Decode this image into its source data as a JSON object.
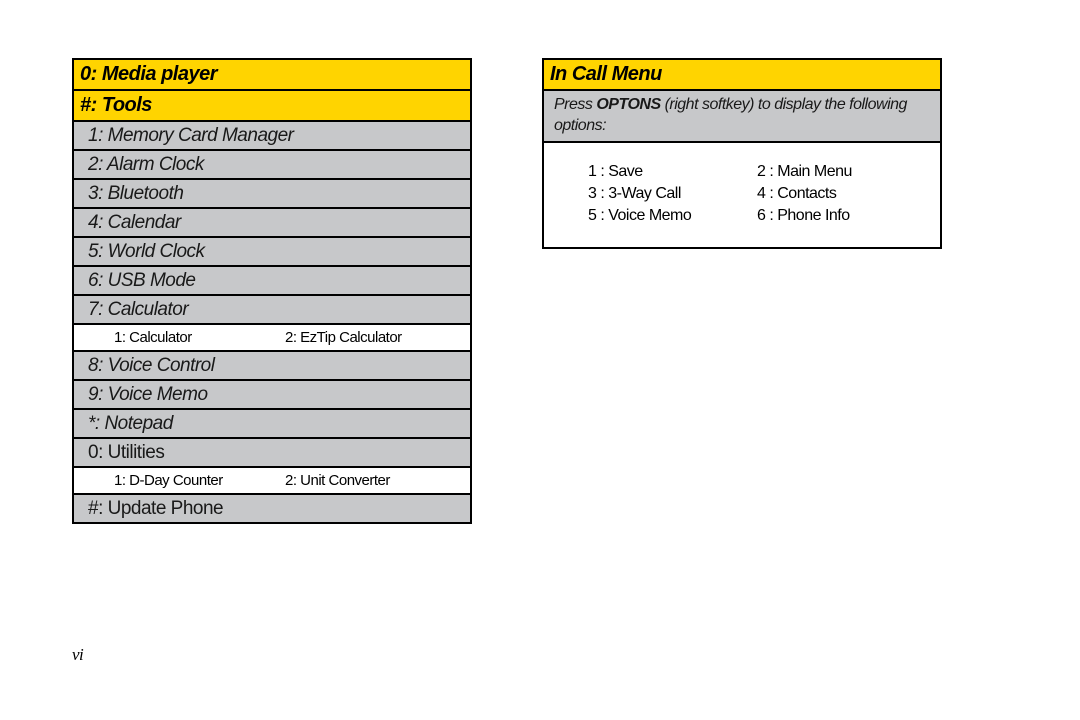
{
  "page_number": "vi",
  "left": {
    "header1": "0: Media player",
    "header2": "#: Tools",
    "rows1": [
      "1: Memory Card Manager",
      "2: Alarm Clock",
      "3: Bluetooth",
      "4: Calendar",
      "5: World Clock",
      "6: USB Mode",
      "7: Calculator"
    ],
    "sub1": {
      "a": "1: Calculator",
      "b": "2: EzTip Calculator"
    },
    "rows2": [
      "8: Voice Control",
      "9: Voice Memo",
      "*: Notepad"
    ],
    "row_utilities": "0: Utilities",
    "sub2": {
      "a": "1: D-Day Counter",
      "b": "2: Unit Converter"
    },
    "row_update": "#: Update Phone"
  },
  "right": {
    "header": "In Call Menu",
    "instruction_pre": "Press ",
    "instruction_bold": "OPTONS",
    "instruction_post": " (right softkey) to display the following options:",
    "options": [
      "1 : Save",
      "2 : Main Menu",
      "3 : 3-Way Call",
      "4 : Contacts",
      "5 : Voice Memo",
      "6 : Phone Info"
    ]
  }
}
